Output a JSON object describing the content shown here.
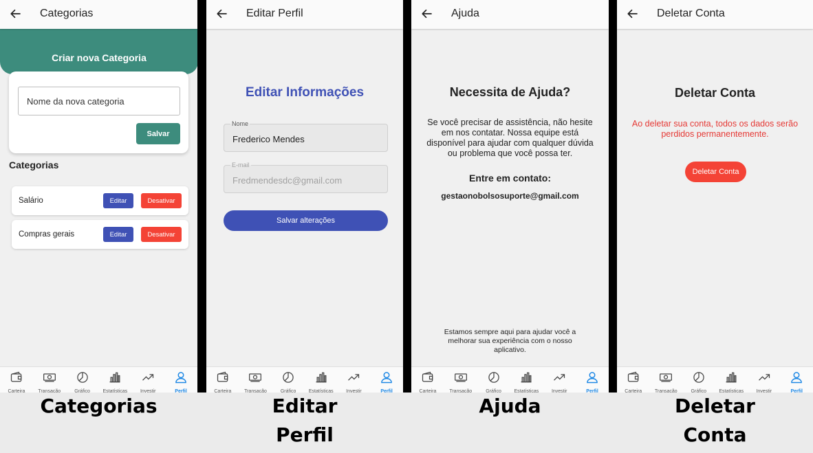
{
  "screens": {
    "categorias": {
      "title": "Categorias",
      "banner": "Criar nova Categoria",
      "input_placeholder": "Nome da nova categoria",
      "save_label": "Salvar",
      "list_heading": "Categorias",
      "items": [
        {
          "name": "Salário",
          "edit": "Editar",
          "deactivate": "Desativar"
        },
        {
          "name": "Compras gerais",
          "edit": "Editar",
          "deactivate": "Desativar"
        }
      ],
      "caption": "Categorias"
    },
    "editar": {
      "title": "Editar Perfil",
      "heading": "Editar Informações",
      "name_label": "Nome",
      "name_value": "Frederico Mendes",
      "email_label": "E-mail",
      "email_value": "Fredmendesdc@gmail.com",
      "save_label": "Salvar alterações",
      "caption_line1": "Editar",
      "caption_line2": "Perfil"
    },
    "ajuda": {
      "title": "Ajuda",
      "heading": "Necessita de Ajuda?",
      "body": "Se você precisar de assistência, não hesite em nos contatar. Nossa equipe está disponível para ajudar com qualquer dúvida ou problema que você possa ter.",
      "contact_heading": "Entre em contato:",
      "email": "gestaonobolsosuporte@gmail.com",
      "footer": "Estamos sempre aqui para ajudar você a melhorar sua experiência com o nosso aplicativo.",
      "caption": "Ajuda"
    },
    "deletar": {
      "title": "Deletar Conta",
      "heading": "Deletar Conta",
      "warning": "Ao deletar sua conta, todos os dados serão perdidos permanentemente.",
      "button": "Deletar Conta",
      "caption_line1": "Deletar",
      "caption_line2": "Conta"
    }
  },
  "nav": [
    "Carteira",
    "Transação",
    "Gráfico",
    "Estatísticas",
    "Investir",
    "Perfil"
  ],
  "colors": {
    "teal": "#3d8c7d",
    "indigo": "#3f51b5",
    "red": "#f44336",
    "nav_active": "#1e88e5"
  },
  "icons": {
    "back": "arrow-left-icon",
    "nav": [
      "wallet-icon",
      "money-icon",
      "pie-chart-icon",
      "bar-chart-icon",
      "trending-up-icon",
      "user-icon"
    ]
  }
}
